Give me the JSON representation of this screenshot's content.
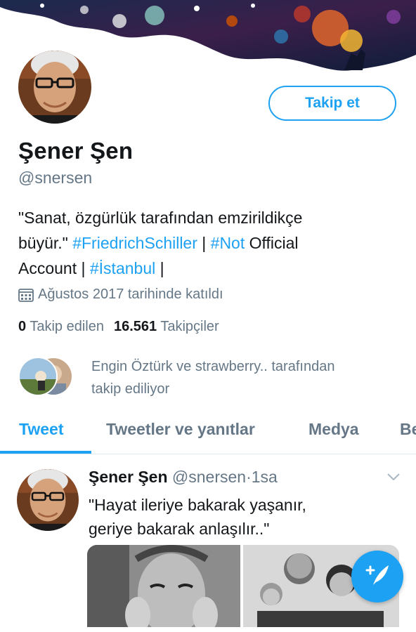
{
  "profile": {
    "name": "Şener Şen",
    "handle": "@snersen",
    "follow_label": "Takip et",
    "bio": {
      "line1": "\"Sanat, özgürlük tarafından emzirildikçe",
      "line2_a": "büyür.\" ",
      "line2_tag1": "#FriedrichSchiller",
      "line2_b": " | ",
      "line2_tag2": "#Not",
      "line2_c": " Official",
      "line3_a": "Account | ",
      "line3_tag": "#İstanbul",
      "line3_b": " |"
    },
    "joined": "Ağustos 2017 tarihinde katıldı",
    "following_count": "0",
    "following_label": "Takip edilen",
    "followers_count": "16.561",
    "followers_label": "Takipçiler",
    "followed_by": {
      "line1": "Engin Öztürk ve strawberry.. tarafından",
      "line2": "takip ediliyor"
    }
  },
  "tabs": [
    {
      "label": "Tweet",
      "active": true
    },
    {
      "label": "Tweetler ve yanıtlar",
      "active": false
    },
    {
      "label": "Medya",
      "active": false
    },
    {
      "label": "Be",
      "active": false
    }
  ],
  "tweet": {
    "name": "Şener Şen",
    "handle": "@snersen",
    "separator": "·",
    "time": "1sa",
    "line1": "\"Hayat ileriye bakarak yaşanır,",
    "line2": "geriye bakarak anlaşılır..\""
  },
  "icons": {
    "joined": "calendar-icon",
    "chevron": "chevron-down-icon",
    "compose": "compose-tweet-icon"
  },
  "colors": {
    "accent": "#1da1f2",
    "secondary_text": "#657786",
    "primary_text": "#14171a"
  }
}
